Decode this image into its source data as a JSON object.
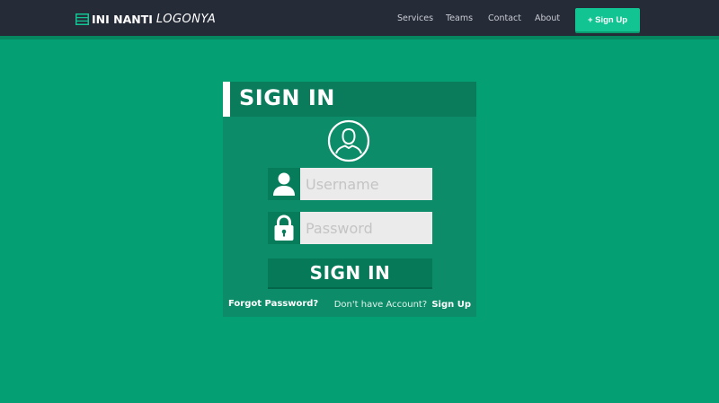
{
  "navbar": {
    "brand_bold": "INI NANTI",
    "brand_light": "LOGONYA",
    "brand_icon": "server-stack-icon",
    "links": [
      "Services",
      "Teams",
      "Contact",
      "About"
    ],
    "signup_label": "+ Sign Up"
  },
  "login": {
    "title": "SIGN IN",
    "avatar_icon": "user-circle-icon",
    "username": {
      "icon": "user-icon",
      "placeholder": "Username",
      "value": ""
    },
    "password": {
      "icon": "lock-icon",
      "placeholder": "Password",
      "value": ""
    },
    "submit_label": "SIGN IN",
    "forgot_label": "Forgot Password?",
    "account_prompt": "Don't have Account?",
    "account_link": "Sign Up"
  },
  "colors": {
    "background": "#04a074",
    "navbar": "#262b38",
    "accent": "#13c493",
    "panel": "#0c8c69",
    "panel_header": "#0a7c5c"
  }
}
